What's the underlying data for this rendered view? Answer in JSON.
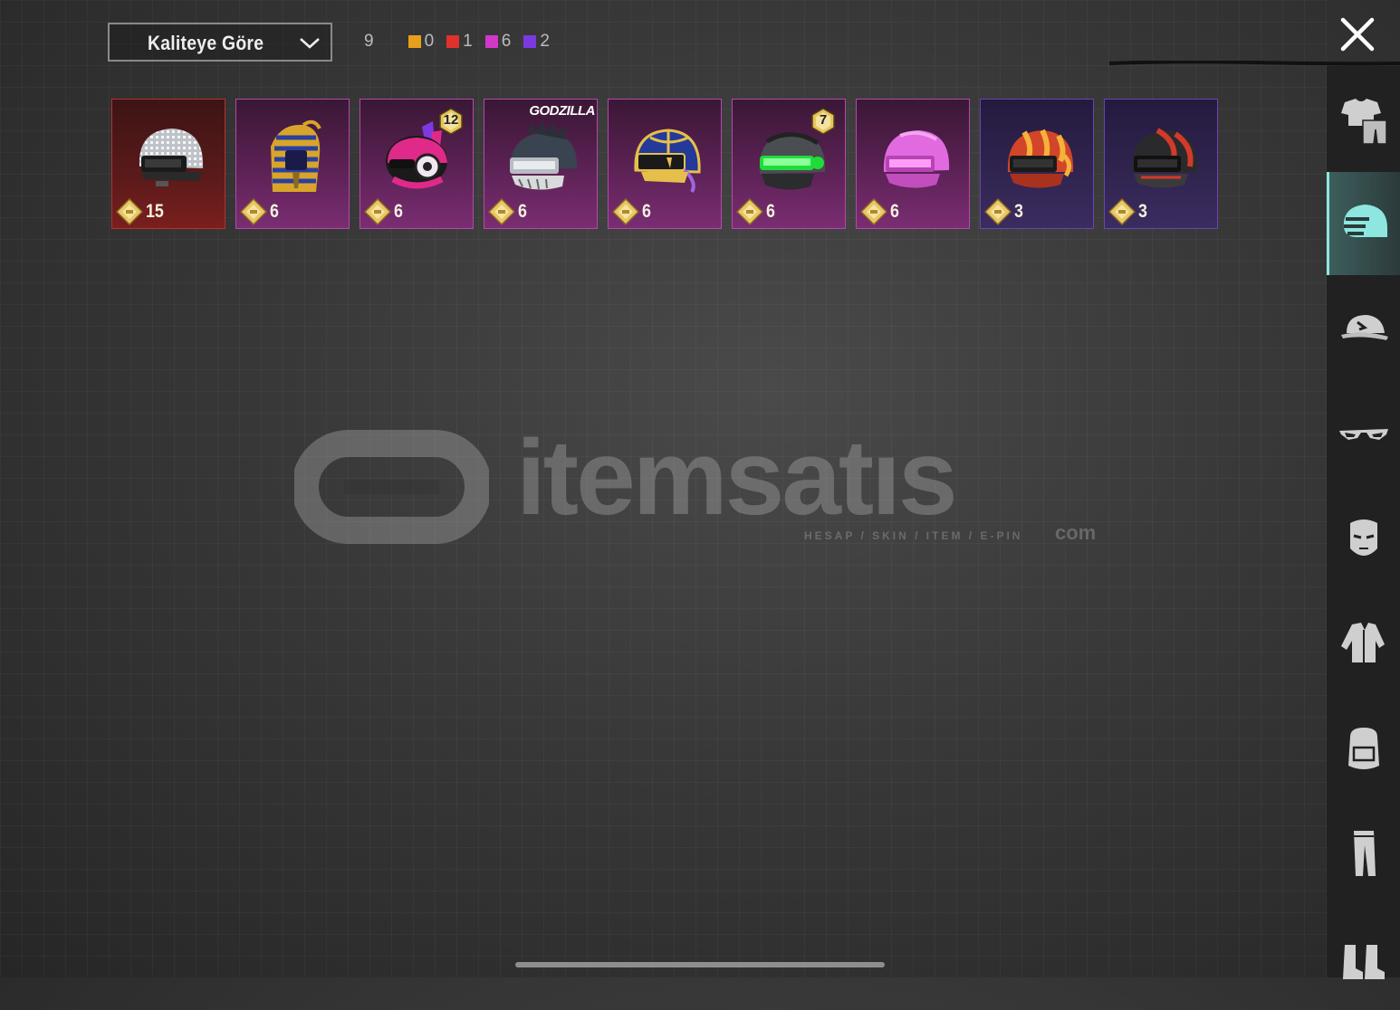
{
  "sort": {
    "label": "Kaliteye Göre"
  },
  "counts": {
    "total": "9",
    "tiers": [
      {
        "color": "#e8a01c",
        "count": "0"
      },
      {
        "color": "#e0312c",
        "count": "1"
      },
      {
        "color": "#d238c8",
        "count": "6"
      },
      {
        "color": "#7a3ae0",
        "count": "2"
      }
    ]
  },
  "items": [
    {
      "quality": "red",
      "value": "15",
      "icon": "disco-helmet-icon"
    },
    {
      "quality": "pink",
      "value": "6",
      "icon": "pharaoh-helmet-icon"
    },
    {
      "quality": "pink",
      "value": "6",
      "icon": "bunny-helmet-icon",
      "badge": "12"
    },
    {
      "quality": "pink",
      "value": "6",
      "icon": "godzilla-helmet-icon",
      "tag": "GODZILLA"
    },
    {
      "quality": "pink",
      "value": "6",
      "icon": "royal-helmet-icon"
    },
    {
      "quality": "pink",
      "value": "6",
      "icon": "neon-green-helmet-icon",
      "badge": "7"
    },
    {
      "quality": "pink",
      "value": "6",
      "icon": "pink-helmet-icon"
    },
    {
      "quality": "purple",
      "value": "3",
      "icon": "flame-helmet-icon"
    },
    {
      "quality": "purple",
      "value": "3",
      "icon": "red-stripe-helmet-icon"
    }
  ],
  "sidebar": [
    {
      "icon": "outfit-icon",
      "active": false
    },
    {
      "icon": "helmet-icon",
      "active": true
    },
    {
      "icon": "cap-icon",
      "active": false
    },
    {
      "icon": "glasses-icon",
      "active": false
    },
    {
      "icon": "mask-icon",
      "active": false
    },
    {
      "icon": "jacket-icon",
      "active": false
    },
    {
      "icon": "backpack-icon",
      "active": false
    },
    {
      "icon": "pants-icon",
      "active": false
    },
    {
      "icon": "boots-icon",
      "active": false
    }
  ],
  "watermark": {
    "word": "itemsatıs",
    "sub": "HESAP / SKIN / ITEM / E-PIN",
    "com": "com"
  }
}
